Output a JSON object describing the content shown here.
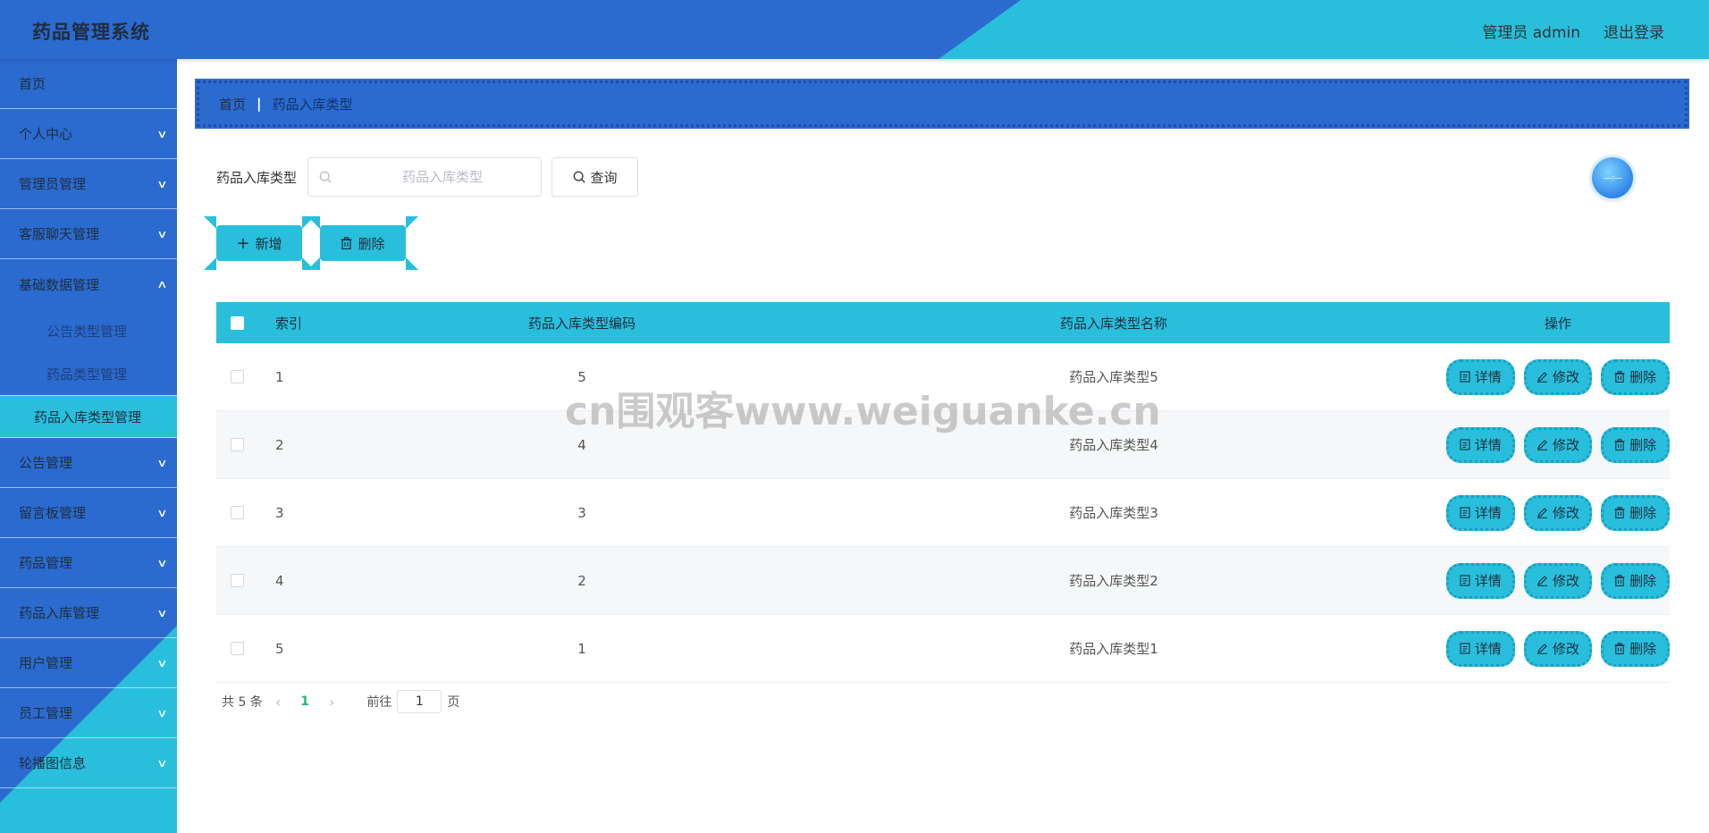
{
  "header": {
    "title": "药品管理系统",
    "user_label": "管理员 admin",
    "logout_label": "退出登录",
    "colors": {
      "primary": "#2b6bcf",
      "accent": "#29bfdc"
    }
  },
  "sidebar": {
    "items": [
      {
        "label": "首页",
        "has_children": false
      },
      {
        "label": "个人中心",
        "has_children": true
      },
      {
        "label": "管理员管理",
        "has_children": true
      },
      {
        "label": "客服聊天管理",
        "has_children": true
      },
      {
        "label": "基础数据管理",
        "has_children": true,
        "expanded": true,
        "children": [
          {
            "label": "公告类型管理"
          },
          {
            "label": "药品类型管理"
          },
          {
            "label": "药品入库类型管理",
            "active": true
          }
        ]
      },
      {
        "label": "公告管理",
        "has_children": true
      },
      {
        "label": "留言板管理",
        "has_children": true
      },
      {
        "label": "药品管理",
        "has_children": true
      },
      {
        "label": "药品入库管理",
        "has_children": true
      },
      {
        "label": "用户管理",
        "has_children": true
      },
      {
        "label": "员工管理",
        "has_children": true
      },
      {
        "label": "轮播图信息",
        "has_children": true
      }
    ]
  },
  "breadcrumb": {
    "home": "首页",
    "current": "药品入库类型"
  },
  "search": {
    "label": "药品入库类型",
    "placeholder": "药品入库类型",
    "value": "",
    "query_label": "查询"
  },
  "avatar_text": "—:—",
  "actions": {
    "add_label": "新增",
    "delete_label": "删除"
  },
  "table": {
    "headers": {
      "index": "索引",
      "code": "药品入库类型编码",
      "name": "药品入库类型名称",
      "ops": "操作"
    },
    "row_buttons": {
      "detail": "详情",
      "edit": "修改",
      "delete": "删除"
    },
    "rows": [
      {
        "index": "1",
        "code": "5",
        "name": "药品入库类型5"
      },
      {
        "index": "2",
        "code": "4",
        "name": "药品入库类型4"
      },
      {
        "index": "3",
        "code": "3",
        "name": "药品入库类型3"
      },
      {
        "index": "4",
        "code": "2",
        "name": "药品入库类型2"
      },
      {
        "index": "5",
        "code": "1",
        "name": "药品入库类型1"
      }
    ]
  },
  "pager": {
    "total": "共 5 条",
    "current": "1",
    "goto_label": "前往",
    "goto_value": "1",
    "page_unit": "页"
  },
  "watermark": "cn围观客www.weiguanke.cn"
}
